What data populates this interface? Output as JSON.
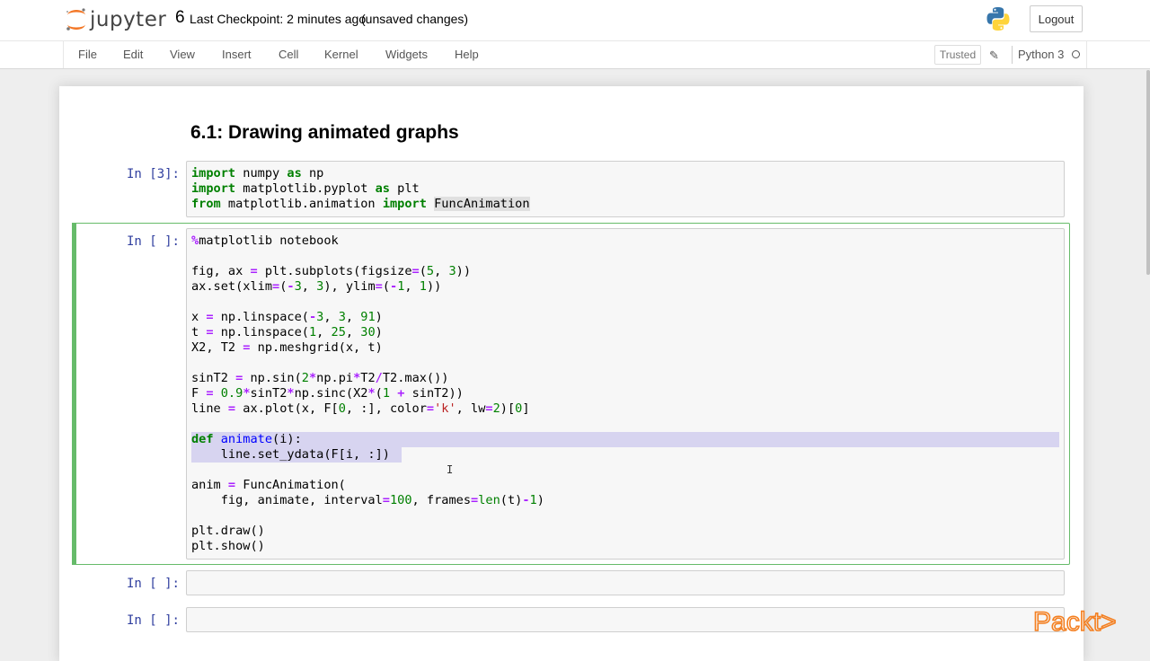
{
  "header": {
    "logo_text": "jupyter",
    "notebook_title": "6",
    "checkpoint": "Last Checkpoint: 2 minutes ago",
    "unsaved": "(unsaved changes)",
    "logout_label": "Logout"
  },
  "menubar": {
    "items": [
      "File",
      "Edit",
      "View",
      "Insert",
      "Cell",
      "Kernel",
      "Widgets",
      "Help"
    ],
    "trusted_label": "Trusted",
    "kernel_name": "Python 3"
  },
  "notebook": {
    "heading": "6.1: Drawing animated graphs",
    "cells": [
      {
        "prompt": "In [3]:",
        "lines": [
          "import numpy as np",
          "import matplotlib.pyplot as plt",
          "from matplotlib.animation import FuncAnimation"
        ]
      },
      {
        "prompt": "In [ ]:",
        "lines": [
          "%matplotlib notebook",
          "",
          "fig, ax = plt.subplots(figsize=(5, 3))",
          "ax.set(xlim=(-3, 3), ylim=(-1, 1))",
          "",
          "x = np.linspace(-3, 3, 91)",
          "t = np.linspace(1, 25, 30)",
          "X2, T2 = np.meshgrid(x, t)",
          "",
          "sinT2 = np.sin(2*np.pi*T2/T2.max())",
          "F = 0.9*sinT2*np.sinc(X2*(1 + sinT2))",
          "line = ax.plot(x, F[0, :], color='k', lw=2)[0]",
          "",
          "def animate(i):",
          "    line.set_ydata(F[i, :])",
          "",
          "anim = FuncAnimation(",
          "    fig, animate, interval=100, frames=len(t)-1)",
          "",
          "plt.draw()",
          "plt.show()"
        ]
      },
      {
        "prompt": "In [ ]:",
        "lines": []
      },
      {
        "prompt": "In [ ]:",
        "lines": []
      }
    ]
  },
  "watermark": {
    "text": "Packt>",
    "color": "#F47F20"
  },
  "colors": {
    "prompt": "#303F9F",
    "keyword": "#008000",
    "operator": "#AA22FF",
    "selection_border": "#66BB6A"
  }
}
